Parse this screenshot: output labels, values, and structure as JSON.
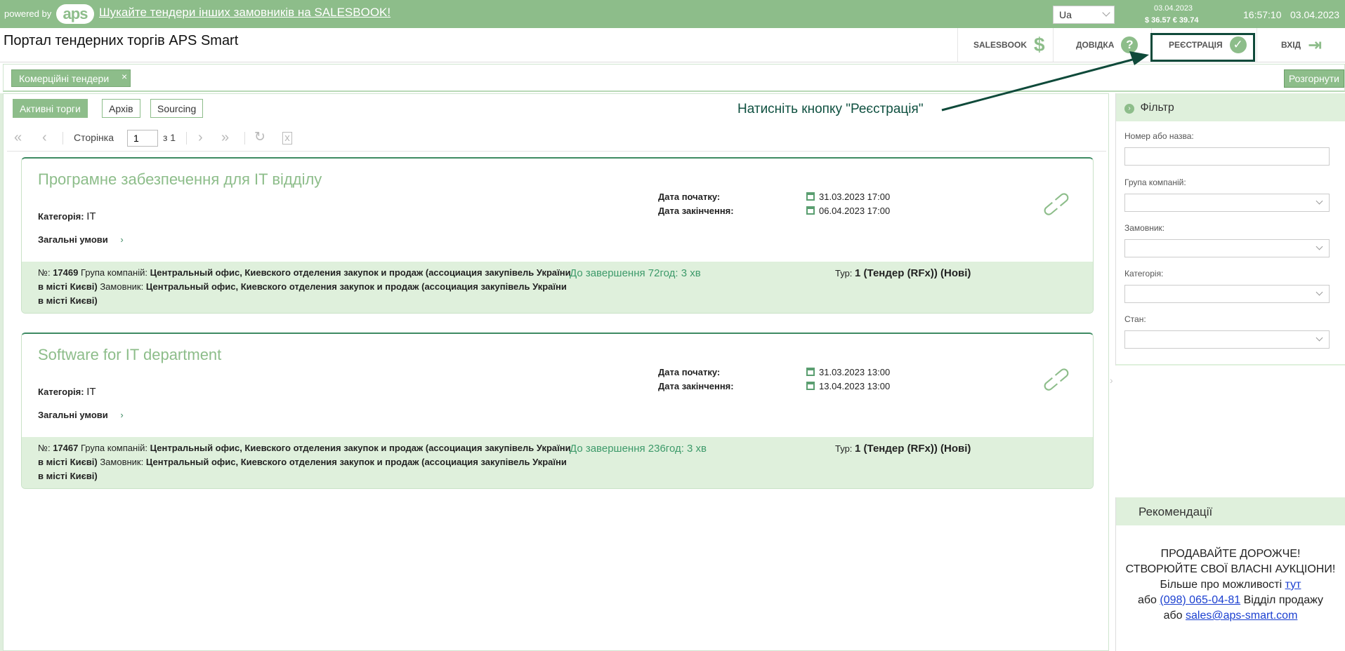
{
  "topbar": {
    "powered_by": "powered by",
    "logo_text": "aps",
    "promo_link": "Шукайте тендери інших замовників на SALESBOOK!",
    "language": "Ua",
    "rates_date": "03.04.2023",
    "rates": "$ 36.57  € 39.74",
    "time": "16:57:10",
    "date": "03.04.2023"
  },
  "header": {
    "title": "Портал тендерних торгів APS Smart",
    "nav": {
      "salesbook": "SALESBOOK",
      "help": "ДОВІДКА",
      "register": "РЕЄСТРАЦІЯ",
      "login": "ВХІД"
    }
  },
  "tabs": {
    "commercial": "Комерційні тендери",
    "close_symbol": "×",
    "expand": "Розгорнути"
  },
  "subtabs": {
    "active": "Активні торги",
    "archive": "Архів",
    "sourcing": "Sourcing"
  },
  "hint": "Натисніть кнопку \"Реєстрація\"",
  "pager": {
    "page_label": "Сторінка",
    "page_value": "1",
    "of_label": "з 1"
  },
  "labels": {
    "category": "Категорія:",
    "general_terms": "Загальні умови",
    "start_date": "Дата початку:",
    "end_date": "Дата закінчення:",
    "number": "№:",
    "company_group": "Група компаній:",
    "customer": "Замовник:",
    "tour": "Тур:"
  },
  "tenders": [
    {
      "title": "Програмне забезпечення для IT відділу",
      "category": "IT",
      "start": "31.03.2023 17:00",
      "end": "06.04.2023 17:00",
      "number": "17469",
      "company_group": "Центральный офис, Киевского отделения закупок и продаж (ассоциация закупівель України в місті Києві)",
      "customer": "Центральный офис, Киевского отделения закупок и продаж (ассоциация закупівель України в місті Києві)",
      "timer": "До завершення 72год: 3 хв",
      "tour": "1 (Тендер (RFx)) (Нові)"
    },
    {
      "title": "Software for IT department",
      "category": "IT",
      "start": "31.03.2023 13:00",
      "end": "13.04.2023 13:00",
      "number": "17467",
      "company_group": "Центральный офис, Киевского отделения закупок и продаж (ассоциация закупівель України в місті Києві)",
      "customer": "Центральный офис, Киевского отделения закупок и продаж (ассоциация закупівель України в місті Києві)",
      "timer": "До завершення 236год: 3 хв",
      "tour": "1 (Тендер (RFx)) (Нові)"
    }
  ],
  "filter": {
    "title": "Фільтр",
    "fields": {
      "number_or_name": "Номер або назва:",
      "company_group": "Група компаній:",
      "customer": "Замовник:",
      "category": "Категорія:",
      "state": "Стан:"
    }
  },
  "recommendations": {
    "title": "Рекомендації",
    "line1": "ПРОДАВАЙТЕ ДОРОЖЧЕ!",
    "line2": "СТВОРЮЙТЕ СВОЇ ВЛАСНІ АУКЦІОНИ!",
    "line3_text": "Більше про можливості",
    "line3_link": "тут",
    "line4_prefix": "або",
    "line4_phone": "(098) 065-04-81",
    "line4_suffix": "Відділ продажу",
    "line5_prefix": "або",
    "line5_email": "sales@aps-smart.com"
  },
  "colors": {
    "brand_green": "#8dbd8a",
    "light_green": "#dff0dc",
    "dark_green": "#0f4a3a",
    "timer_green": "#3d9a6a"
  }
}
